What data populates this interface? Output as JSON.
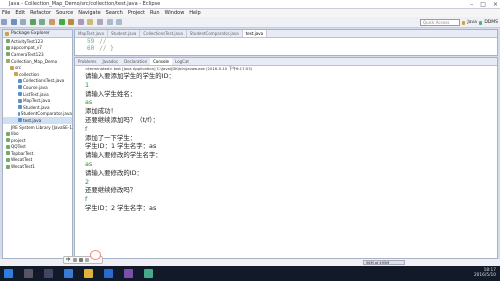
{
  "window": {
    "title": "Java - Collection_Map_Demo/src/collection/test.java - Eclipse",
    "controls": [
      "–",
      "□",
      "×"
    ]
  },
  "menu": [
    "File",
    "Edit",
    "Refactor",
    "Source",
    "Navigate",
    "Search",
    "Project",
    "Run",
    "Window",
    "Help"
  ],
  "toolbar": {
    "quick_access": "Quick Access",
    "perspective_java": "Java",
    "perspective_ddms": "DDMS"
  },
  "package_explorer": {
    "title": "Package Explorer",
    "items": [
      {
        "label": "ActivityTest123",
        "indent": 0,
        "color": "#7a6"
      },
      {
        "label": "appcompat_v7",
        "indent": 0,
        "color": "#7a6"
      },
      {
        "label": "CameraTest123",
        "indent": 0,
        "color": "#7a6"
      },
      {
        "label": "Collection_Map_Demo",
        "indent": 0,
        "color": "#9a6"
      },
      {
        "label": "src",
        "indent": 1,
        "color": "#c9a24a"
      },
      {
        "label": "collection",
        "indent": 2,
        "color": "#c9a24a"
      },
      {
        "label": "CollectionsTest.java",
        "indent": 3,
        "color": "#5a8fd0"
      },
      {
        "label": "Course.java",
        "indent": 3,
        "color": "#5a8fd0"
      },
      {
        "label": "ListTest.java",
        "indent": 3,
        "color": "#5a8fd0"
      },
      {
        "label": "MapTest.java",
        "indent": 3,
        "color": "#5a8fd0"
      },
      {
        "label": "Student.java",
        "indent": 3,
        "color": "#5a8fd0"
      },
      {
        "label": "StudentComparator.java",
        "indent": 3,
        "color": "#5a8fd0"
      },
      {
        "label": "test.java",
        "indent": 3,
        "color": "#5a8fd0"
      },
      {
        "label": "JRE System Library [JavaSE-1.7]",
        "indent": 1,
        "color": "#a87"
      },
      {
        "label": "libo",
        "indent": 0,
        "color": "#7a6"
      },
      {
        "label": "project",
        "indent": 0,
        "color": "#7a6"
      },
      {
        "label": "QQTest",
        "indent": 0,
        "color": "#7a6"
      },
      {
        "label": "TopbarTest",
        "indent": 0,
        "color": "#7a6"
      },
      {
        "label": "WecatTest",
        "indent": 0,
        "color": "#7a6"
      },
      {
        "label": "WecatTest1",
        "indent": 0,
        "color": "#7a6"
      }
    ]
  },
  "editor": {
    "tabs": [
      "MapTest.java",
      "Student.java",
      "CollectionsTest.java",
      "StudentComparator.java",
      "test.java"
    ],
    "active_tab": 4,
    "lines": [
      {
        "num": "59",
        "text": "//"
      },
      {
        "num": "60",
        "text": "//        }"
      }
    ]
  },
  "console": {
    "tabs": [
      "Problems",
      "Javadoc",
      "Declaration",
      "Console",
      "LogCat"
    ],
    "active_tab": 3,
    "terminated": "<terminated> test [Java Application] C:\\Java\\JDK\\bin\\javaw.exe (2016-5-10 下午6:17:03)",
    "lines": [
      {
        "text": "请输入要添加学生的学生的ID：",
        "input": false
      },
      {
        "text": "1",
        "input": true
      },
      {
        "text": "请输入学生姓名：",
        "input": false
      },
      {
        "text": "as",
        "input": true
      },
      {
        "text": "添加成功！",
        "input": false
      },
      {
        "text": "还要继续添加吗？（t/f）：",
        "input": false
      },
      {
        "text": "f",
        "input": true
      },
      {
        "text": "添加了一下学生：",
        "input": false
      },
      {
        "text": "学生ID：1 学生名字：as",
        "input": false
      },
      {
        "text": "请输入要修改的学生名字：",
        "input": false
      },
      {
        "text": "as",
        "input": true
      },
      {
        "text": "请输入要修改的ID：",
        "input": false
      },
      {
        "text": "2",
        "input": true
      },
      {
        "text": "还要继续修改吗？",
        "input": false
      },
      {
        "text": "f",
        "input": true
      },
      {
        "text": "学生ID：2 学生名字：as",
        "input": false
      }
    ]
  },
  "status": {
    "memory": "56M of 495M"
  },
  "ime": {
    "label": "中"
  },
  "taskbar": {
    "time": "18:17",
    "date": "2016/5/10"
  }
}
